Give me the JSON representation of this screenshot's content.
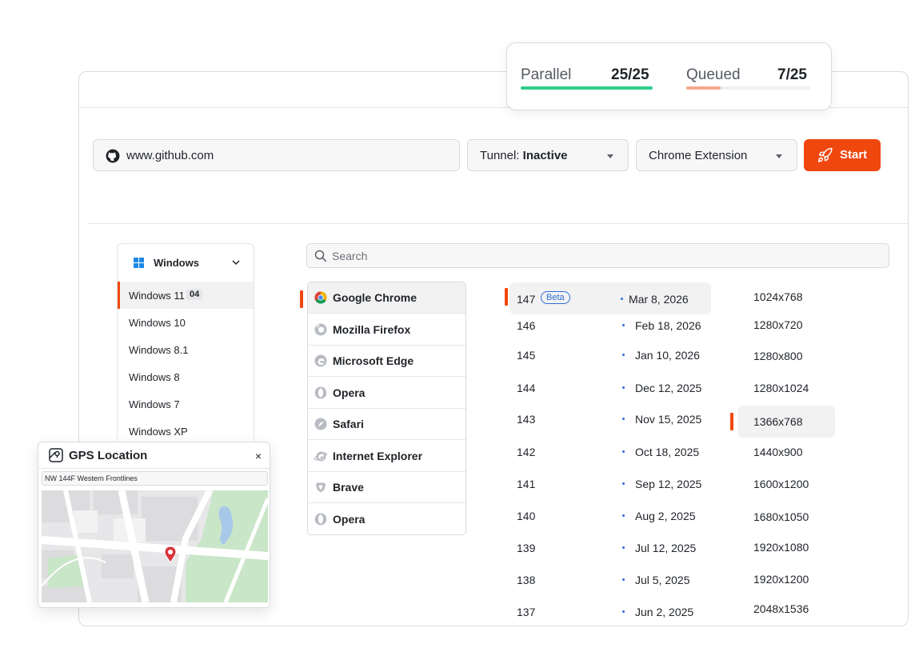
{
  "stats": {
    "parallel_label": "Parallel",
    "parallel_value": "25/25",
    "parallel_progress": 1.0,
    "parallel_color": "#2ecc8a",
    "queued_label": "Queued",
    "queued_value": "7/25",
    "queued_progress": 0.28,
    "queued_color": "#f4a98a"
  },
  "toolbar": {
    "url_value": "www.github.com",
    "tunnel_prefix": "Tunnel:",
    "tunnel_status": "Inactive",
    "extension_label": "Chrome Extension",
    "start_label": "Start",
    "accent_color": "#f0470e"
  },
  "os": {
    "selected_family": "Windows",
    "items": [
      {
        "label": "Windows 11",
        "badge": "04",
        "active": true
      },
      {
        "label": "Windows 10"
      },
      {
        "label": "Windows 8.1"
      },
      {
        "label": "Windows 8"
      },
      {
        "label": "Windows 7"
      },
      {
        "label": "Windows XP"
      }
    ]
  },
  "search": {
    "placeholder": "Search"
  },
  "browsers": [
    {
      "label": "Google Chrome",
      "icon": "chrome-icon",
      "active": true
    },
    {
      "label": "Mozilla Firefox",
      "icon": "firefox-icon"
    },
    {
      "label": "Microsoft Edge",
      "icon": "edge-icon"
    },
    {
      "label": "Opera",
      "icon": "opera-icon"
    },
    {
      "label": "Safari",
      "icon": "safari-icon"
    },
    {
      "label": "Internet Explorer",
      "icon": "ie-icon"
    },
    {
      "label": "Brave",
      "icon": "brave-icon"
    },
    {
      "label": "Opera",
      "icon": "opera-icon"
    }
  ],
  "versions": [
    {
      "number": "147",
      "badge": "Beta",
      "date": "Mar 8, 2026",
      "active": true
    },
    {
      "number": "146",
      "date": "Feb 18, 2026"
    },
    {
      "number": "145",
      "date": "Jan 10, 2026"
    },
    {
      "number": "144",
      "date": "Dec 12, 2025"
    },
    {
      "number": "143",
      "date": "Nov 15, 2025"
    },
    {
      "number": "142",
      "date": "Oct 18, 2025"
    },
    {
      "number": "141",
      "date": "Sep 12, 2025"
    },
    {
      "number": "140",
      "date": "Aug 2, 2025"
    },
    {
      "number": "139",
      "date": "Jul 12, 2025"
    },
    {
      "number": "138",
      "date": "Jul 5, 2025"
    },
    {
      "number": "137",
      "date": "Jun 2, 2025"
    }
  ],
  "resolutions": [
    {
      "label": "1024x768"
    },
    {
      "label": "1280x720"
    },
    {
      "label": "1280x800"
    },
    {
      "label": "1280x1024"
    },
    {
      "label": "1366x768",
      "active": true
    },
    {
      "label": "1440x900"
    },
    {
      "label": "1600x1200"
    },
    {
      "label": "1680x1050"
    },
    {
      "label": "1920x1080"
    },
    {
      "label": "1920x1200"
    },
    {
      "label": "2048x1536"
    }
  ],
  "gps": {
    "title": "GPS Location",
    "close_label": "×",
    "address": "NW 144F Western Frontlines",
    "pin_color": "#d9353a"
  }
}
